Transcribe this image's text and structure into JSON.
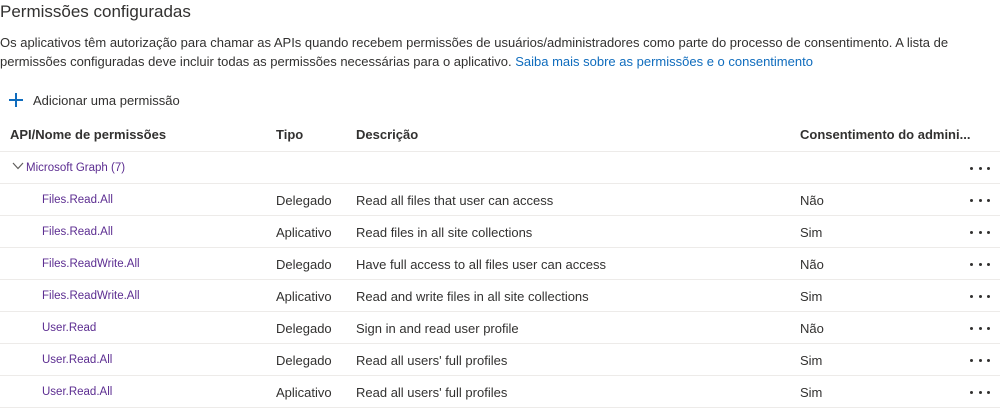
{
  "section": {
    "title": "Permissões configuradas",
    "description": "Os aplicativos têm autorização para chamar as APIs quando recebem permissões de usuários/administradores como parte do processo de consentimento. A lista de permissões configuradas deve incluir todas as permissões necessárias para o aplicativo.",
    "learn_more_link": "Saiba mais sobre as permissões e o consentimento"
  },
  "toolbar": {
    "add_permission_label": "Adicionar uma permissão"
  },
  "colors": {
    "accent": "#0f6cbd",
    "permission_link": "#5c2d91",
    "border": "#edebe9",
    "text": "#323130"
  },
  "table": {
    "columns": [
      "API/Nome de permissões",
      "Tipo",
      "Descrição",
      "Consentimento do admini..."
    ],
    "group": {
      "label": "Microsoft Graph (7)"
    },
    "rows": [
      {
        "name": "Files.Read.All",
        "type": "Delegado",
        "description": "Read all files that user can access",
        "consent": "Não"
      },
      {
        "name": "Files.Read.All",
        "type": "Aplicativo",
        "description": "Read files in all site collections",
        "consent": "Sim"
      },
      {
        "name": "Files.ReadWrite.All",
        "type": "Delegado",
        "description": "Have full access to all files user can access",
        "consent": "Não"
      },
      {
        "name": "Files.ReadWrite.All",
        "type": "Aplicativo",
        "description": "Read and write files in all site collections",
        "consent": "Sim"
      },
      {
        "name": "User.Read",
        "type": "Delegado",
        "description": "Sign in and read user profile",
        "consent": "Não"
      },
      {
        "name": "User.Read.All",
        "type": "Delegado",
        "description": "Read all users' full profiles",
        "consent": "Sim"
      },
      {
        "name": "User.Read.All",
        "type": "Aplicativo",
        "description": "Read all users' full profiles",
        "consent": "Sim"
      }
    ]
  }
}
